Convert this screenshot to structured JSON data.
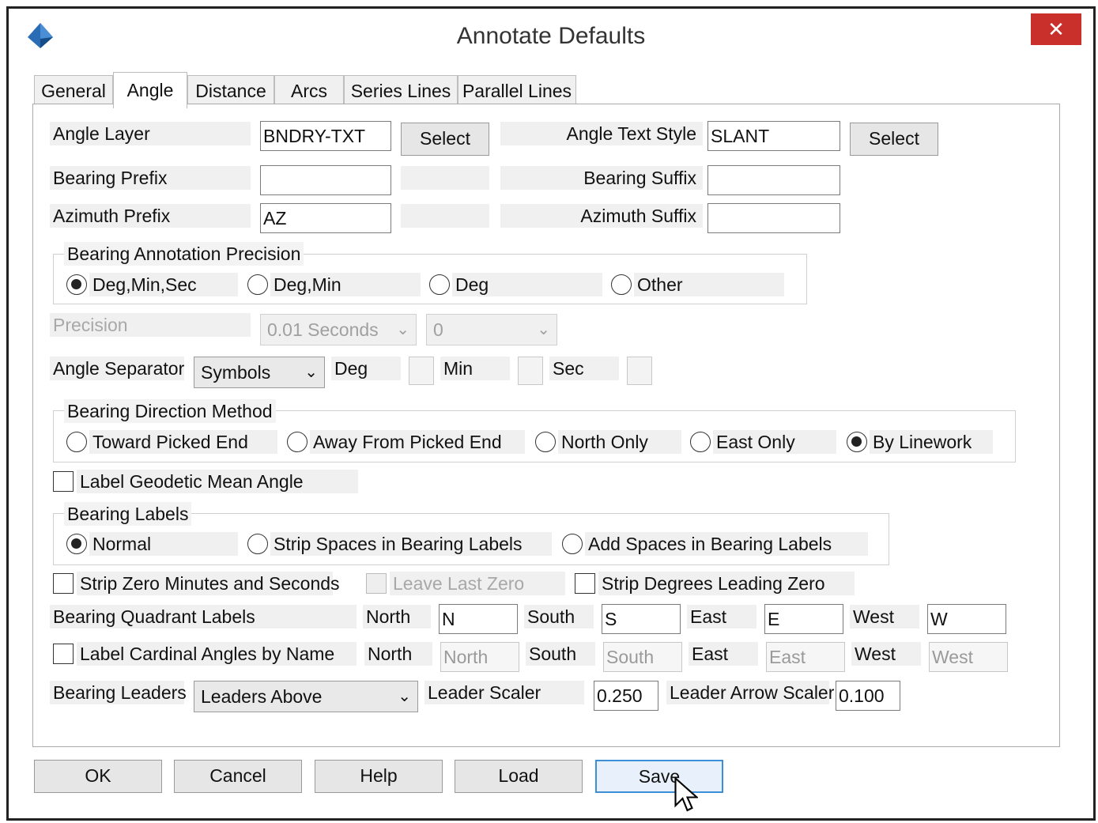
{
  "window": {
    "title": "Annotate Defaults",
    "close_glyph": "✕"
  },
  "tabs": [
    "General",
    "Angle",
    "Distance",
    "Arcs",
    "Series Lines",
    "Parallel Lines"
  ],
  "active_tab": "Angle",
  "angle_layer": {
    "label": "Angle Layer",
    "value": "BNDRY-TXT",
    "button": "Select"
  },
  "angle_text_style": {
    "label": "Angle Text Style",
    "value": "SLANT",
    "button": "Select"
  },
  "bearing_prefix": {
    "label": "Bearing Prefix",
    "value": ""
  },
  "bearing_suffix": {
    "label": "Bearing Suffix",
    "value": ""
  },
  "azimuth_prefix": {
    "label": "Azimuth Prefix",
    "value": "AZ"
  },
  "azimuth_suffix": {
    "label": "Azimuth Suffix",
    "value": ""
  },
  "precision_group": {
    "title": "Bearing Annotation Precision",
    "options": [
      "Deg,Min,Sec",
      "Deg,Min",
      "Deg",
      "Other"
    ],
    "selected": 0
  },
  "precision": {
    "label": "Precision",
    "select1": "0.01 Seconds",
    "select2": "0"
  },
  "angle_separator": {
    "label": "Angle Separator",
    "value": "Symbols",
    "deg": "Deg",
    "min": "Min",
    "sec": "Sec"
  },
  "direction_group": {
    "title": "Bearing Direction Method",
    "options": [
      "Toward Picked End",
      "Away From Picked End",
      "North Only",
      "East Only",
      "By Linework"
    ],
    "selected": 4
  },
  "geodetic": {
    "label": "Label Geodetic Mean Angle",
    "checked": false
  },
  "labels_group": {
    "title": "Bearing Labels",
    "options": [
      "Normal",
      "Strip Spaces in Bearing Labels",
      "Add Spaces in Bearing Labels"
    ],
    "selected": 0
  },
  "strip_zero": {
    "label": "Strip Zero Minutes and Seconds"
  },
  "leave_last_zero": {
    "label": "Leave Last Zero"
  },
  "strip_degrees": {
    "label": "Strip Degrees Leading Zero"
  },
  "quadrant": {
    "label": "Bearing Quadrant Labels",
    "north_label": "North",
    "north": "N",
    "south_label": "South",
    "south": "S",
    "east_label": "East",
    "east": "E",
    "west_label": "West",
    "west": "W"
  },
  "cardinal": {
    "label": "Label Cardinal Angles by Name",
    "north_label": "North",
    "north": "North",
    "south_label": "South",
    "south": "South",
    "east_label": "East",
    "east": "East",
    "west_label": "West",
    "west": "West"
  },
  "leaders": {
    "label": "Bearing Leaders",
    "value": "Leaders Above",
    "scaler_label": "Leader Scaler",
    "scaler": "0.250",
    "arrow_label": "Leader Arrow Scaler",
    "arrow": "0.100"
  },
  "buttons": {
    "ok": "OK",
    "cancel": "Cancel",
    "help": "Help",
    "load": "Load",
    "save": "Save"
  },
  "chevron": "⌄"
}
